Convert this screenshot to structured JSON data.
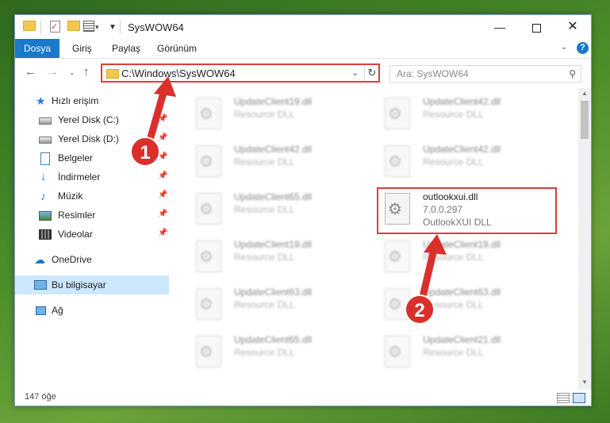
{
  "window": {
    "title": "SysWOW64",
    "qa_check": "✓",
    "qa_drop": "▾",
    "qa_pin": "▼",
    "minimize": "—",
    "close": "✕"
  },
  "ribbon": {
    "tabs": [
      "Dosya",
      "Giriş",
      "Paylaş",
      "Görünüm"
    ],
    "caret": "⌄",
    "help": "?"
  },
  "nav": {
    "back": "←",
    "forward": "→",
    "recent": "⌄",
    "up": "↑",
    "address": "C:\\Windows\\SysWOW64",
    "address_drop": "⌄",
    "refresh": "↻",
    "search_placeholder": "Ara: SysWOW64",
    "search_icon": "⚲"
  },
  "sidebar": {
    "items": [
      {
        "label": "Hızlı erişim",
        "icon": "star-icon",
        "glyph": "★"
      },
      {
        "label": "Yerel Disk (C:)",
        "icon": "drive-icon",
        "pin": "📌"
      },
      {
        "label": "Yerel Disk (D:)",
        "icon": "drive-icon",
        "pin": "📌"
      },
      {
        "label": "Belgeler",
        "icon": "document-icon",
        "pin": "📌"
      },
      {
        "label": "İndirmeler",
        "icon": "download-icon",
        "glyph": "↓",
        "pin": "📌"
      },
      {
        "label": "Müzik",
        "icon": "music-icon",
        "glyph": "♪",
        "pin": "📌"
      },
      {
        "label": "Resimler",
        "icon": "pictures-icon",
        "pin": "📌"
      },
      {
        "label": "Videolar",
        "icon": "videos-icon",
        "pin": "📌"
      },
      {
        "label": "OneDrive",
        "icon": "cloud-icon",
        "glyph": "☁"
      },
      {
        "label": "Bu bilgisayar",
        "icon": "computer-icon"
      },
      {
        "label": "Ağ",
        "icon": "network-icon"
      }
    ]
  },
  "files": [
    {
      "name": "UpdateClient19.dll",
      "type": "Resource DLL"
    },
    {
      "name": "UpdateClient42.dll",
      "type": "Resource DLL"
    },
    {
      "name": "UpdateClient42.dll",
      "type": "Resource DLL"
    },
    {
      "name": "UpdateClient42.dll",
      "type": "Resource DLL"
    },
    {
      "name": "UpdateClient65.dll",
      "type": "Resource DLL"
    },
    {
      "name": "outlookxui.dll",
      "version": "7.0.0.297",
      "type": "OutlookXUI DLL"
    },
    {
      "name": "UpdateClient19.dll",
      "type": "Resource DLL"
    },
    {
      "name": "UpdateClient19.dll",
      "type": "Resource DLL"
    },
    {
      "name": "UpdateClient63.dll",
      "type": "Resource DLL"
    },
    {
      "name": "UpdateClient63.dll",
      "type": "Resource DLL"
    },
    {
      "name": "UpdateClient65.dll",
      "type": "Resource DLL"
    },
    {
      "name": "UpdateClient21.dll",
      "type": "Resource DLL"
    }
  ],
  "file_icon_glyph": "⚙",
  "scroll": {
    "up": "▲",
    "down": "▼"
  },
  "status": {
    "count": "147 öğe"
  },
  "annotations": {
    "badge1": "1",
    "badge2": "2",
    "color": "#d9302c"
  }
}
